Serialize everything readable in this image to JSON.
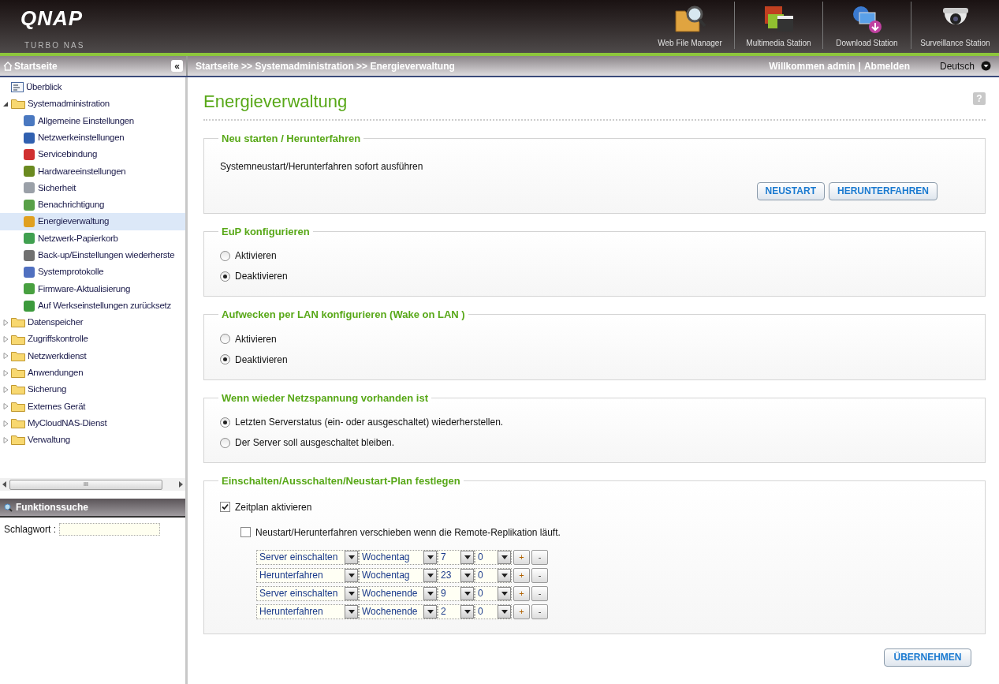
{
  "header": {
    "logo": "QNAP",
    "subtitle": "TURBO NAS",
    "apps": [
      {
        "label": "Web File Manager",
        "kind": "files"
      },
      {
        "label": "Multimedia Station",
        "kind": "media"
      },
      {
        "label": "Download Station",
        "kind": "download"
      },
      {
        "label": "Surveillance Station",
        "kind": "camera"
      }
    ]
  },
  "topbar": {
    "sidebar_title": "Startseite",
    "collapse": "«",
    "breadcrumb": "Startseite >> Systemadministration >> Energieverwaltung",
    "welcome": "Willkommen admin",
    "separator": "|",
    "logout": "Abmelden",
    "language": "Deutsch"
  },
  "sidebar": {
    "items": [
      {
        "label": "Überblick",
        "kind": "page",
        "selected": false
      },
      {
        "label": "Systemadministration",
        "kind": "folder",
        "expanded": true,
        "selected": false,
        "children": [
          {
            "label": "Allgemeine Einstellungen",
            "color": "#4a78c0",
            "selected": false
          },
          {
            "label": "Netzwerkeinstellungen",
            "color": "#3060b0",
            "selected": false
          },
          {
            "label": "Servicebindung",
            "color": "#d03030",
            "selected": false
          },
          {
            "label": "Hardwareeinstellungen",
            "color": "#6a8a20",
            "selected": false
          },
          {
            "label": "Sicherheit",
            "color": "#9aa0a8",
            "selected": false
          },
          {
            "label": "Benachrichtigung",
            "color": "#58a048",
            "selected": false
          },
          {
            "label": "Energieverwaltung",
            "color": "#e0a020",
            "selected": true
          },
          {
            "label": "Netzwerk-Papierkorb",
            "color": "#40a050",
            "selected": false
          },
          {
            "label": "Back-up/Einstellungen wiederherste",
            "color": "#707070",
            "selected": false
          },
          {
            "label": "Systemprotokolle",
            "color": "#5070c0",
            "selected": false
          },
          {
            "label": "Firmware-Aktualisierung",
            "color": "#48a040",
            "selected": false
          },
          {
            "label": "Auf Werkseinstellungen zurücksetz",
            "color": "#3c9a3c",
            "selected": false
          }
        ]
      },
      {
        "label": "Datenspeicher",
        "kind": "folder",
        "expanded": false,
        "selected": false
      },
      {
        "label": "Zugriffskontrolle",
        "kind": "folder",
        "expanded": false,
        "selected": false
      },
      {
        "label": "Netzwerkdienst",
        "kind": "folder",
        "expanded": false,
        "selected": false
      },
      {
        "label": "Anwendungen",
        "kind": "folder",
        "expanded": false,
        "selected": false
      },
      {
        "label": "Sicherung",
        "kind": "folder",
        "expanded": false,
        "selected": false
      },
      {
        "label": "Externes Gerät",
        "kind": "folder",
        "expanded": false,
        "selected": false
      },
      {
        "label": "MyCloudNAS-Dienst",
        "kind": "folder",
        "expanded": false,
        "selected": false
      },
      {
        "label": "Verwaltung",
        "kind": "folder",
        "expanded": false,
        "selected": false
      }
    ],
    "scrollbar_grip": "III"
  },
  "search": {
    "title": "Funktionssuche",
    "label": "Schlagwort :"
  },
  "page": {
    "title": "Energieverwaltung",
    "help": "?",
    "sections": [
      {
        "kind": "actions",
        "legend": "Neu starten / Herunterfahren",
        "text": "Systemneustart/Herunterfahren sofort ausführen",
        "buttons": [
          "NEUSTART",
          "HERUNTERFAHREN"
        ]
      },
      {
        "kind": "radios",
        "legend": "EuP konfigurieren",
        "options": [
          {
            "label": "Aktivieren",
            "selected": false
          },
          {
            "label": "Deaktivieren",
            "selected": true
          }
        ]
      },
      {
        "kind": "radios",
        "legend": "Aufwecken per LAN konfigurieren (Wake on LAN )",
        "options": [
          {
            "label": "Aktivieren",
            "selected": false
          },
          {
            "label": "Deaktivieren",
            "selected": true
          }
        ]
      },
      {
        "kind": "radios",
        "legend": "Wenn wieder Netzspannung vorhanden ist",
        "options": [
          {
            "label": "Letzten Serverstatus (ein- oder ausgeschaltet) wiederherstellen.",
            "selected": true
          },
          {
            "label": "Der Server soll ausgeschaltet bleiben.",
            "selected": false
          }
        ]
      },
      {
        "kind": "schedule",
        "legend": "Einschalten/Ausschalten/Neustart-Plan festlegen",
        "checks": [
          {
            "label": "Zeitplan aktivieren",
            "checked": true,
            "indent": false
          },
          {
            "label": "Neustart/Herunterfahren verschieben wenn die Remote-Replikation läuft.",
            "checked": false,
            "indent": true
          }
        ],
        "rows": [
          {
            "action": "Server einschalten",
            "day": "Wochentag",
            "hour": "7",
            "minute": "0",
            "add": "+",
            "remove": "-"
          },
          {
            "action": "Herunterfahren",
            "day": "Wochentag",
            "hour": "23",
            "minute": "0",
            "add": "+",
            "remove": "-"
          },
          {
            "action": "Server einschalten",
            "day": "Wochenende",
            "hour": "9",
            "minute": "0",
            "add": "+",
            "remove": "-"
          },
          {
            "action": "Herunterfahren",
            "day": "Wochenende",
            "hour": "2",
            "minute": "0",
            "add": "+",
            "remove": "-"
          }
        ]
      }
    ],
    "apply": "ÜBERNEHMEN"
  }
}
